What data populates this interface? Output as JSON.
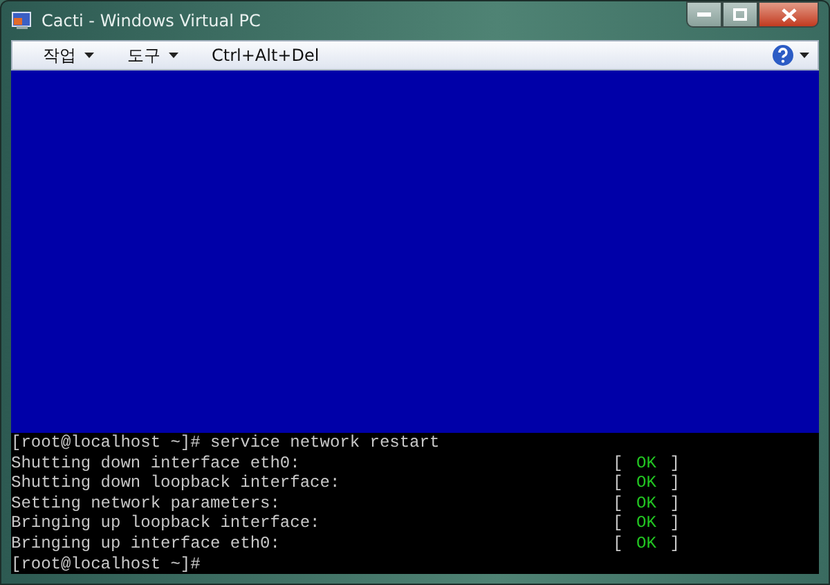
{
  "window": {
    "title": "Cacti - Windows Virtual PC"
  },
  "menu": [
    {
      "label": "작업",
      "kind": "dropdown"
    },
    {
      "label": "도구",
      "kind": "dropdown"
    },
    {
      "label": "Ctrl+Alt+Del",
      "kind": "plain"
    }
  ],
  "terminal": {
    "lines": [
      {
        "kind": "command",
        "text": "[root@localhost ~]# service network restart"
      },
      {
        "kind": "status",
        "text": "Shutting down interface eth0:",
        "open": "[",
        "status": "OK",
        "close": "]"
      },
      {
        "kind": "status",
        "text": "Shutting down loopback interface:",
        "open": "[",
        "status": "OK",
        "close": "]"
      },
      {
        "kind": "status",
        "text": "Setting network parameters:",
        "open": "[",
        "status": "OK",
        "close": "]"
      },
      {
        "kind": "status",
        "text": "Bringing up loopback interface:",
        "open": "[",
        "status": "OK",
        "close": "]"
      },
      {
        "kind": "status",
        "text": "Bringing up interface eth0:",
        "open": "[",
        "status": "OK",
        "close": "]"
      },
      {
        "kind": "command",
        "text": "[root@localhost ~]#"
      }
    ]
  }
}
